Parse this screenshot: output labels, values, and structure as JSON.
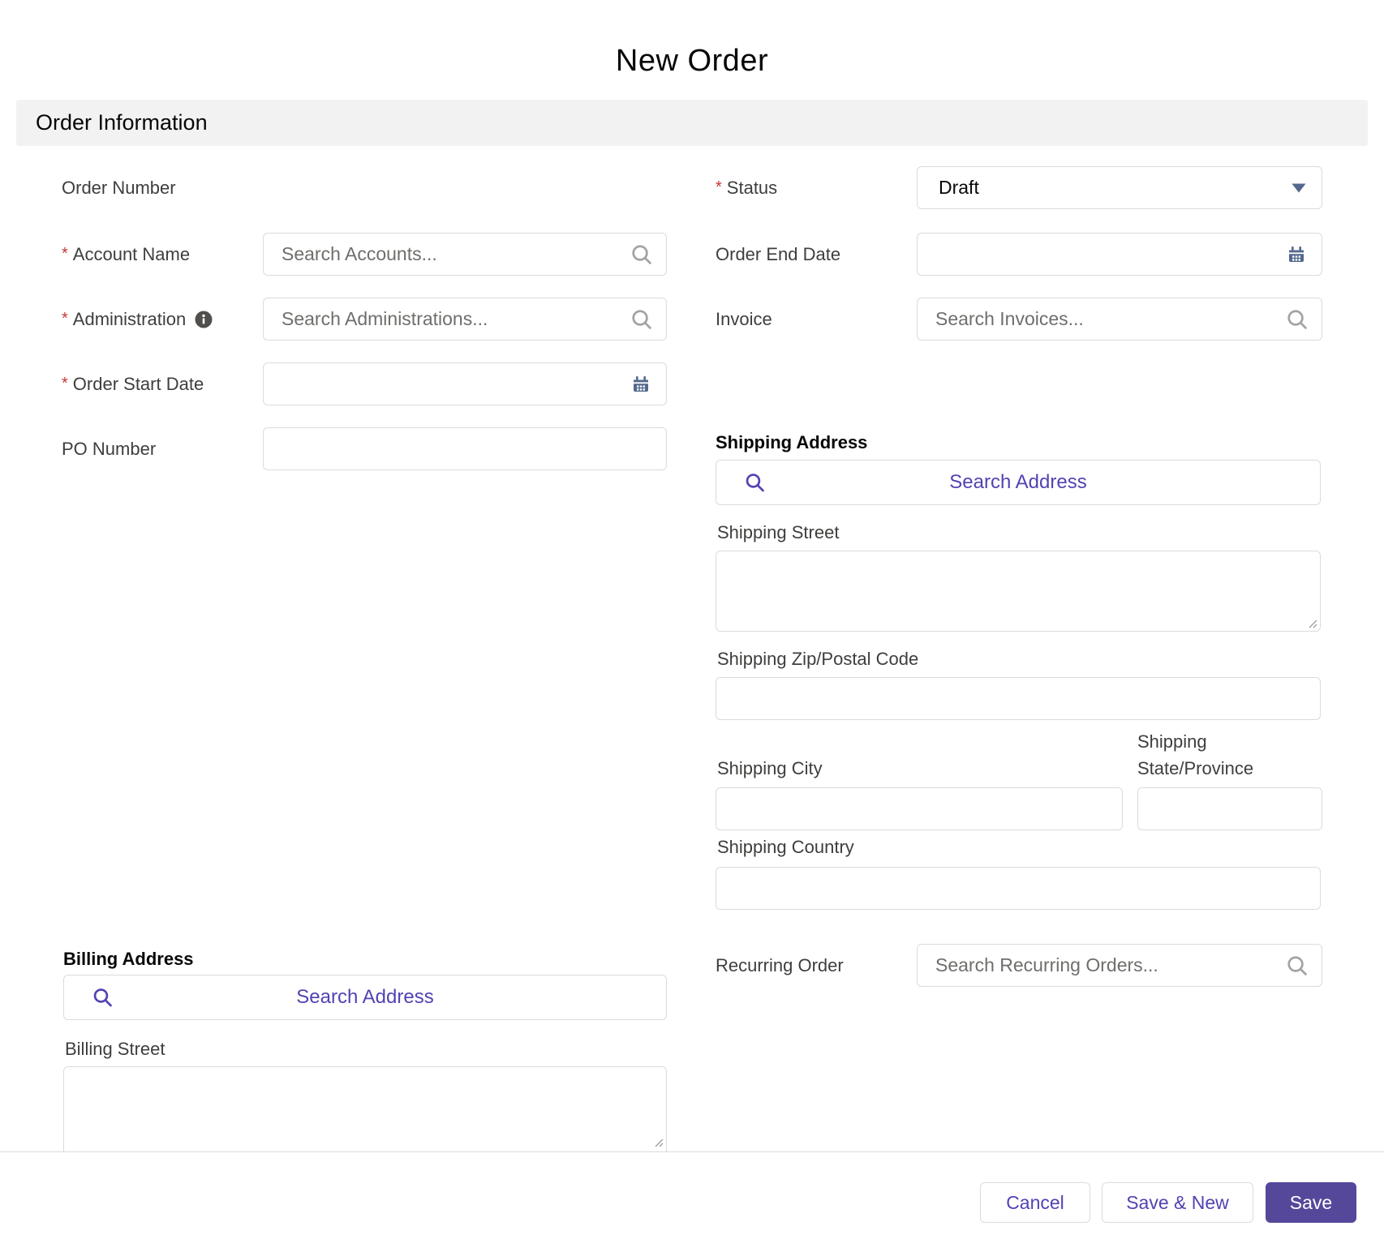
{
  "title": "New Order",
  "section_header": "Order Information",
  "colors": {
    "accent": "#5143b3",
    "save_bg": "#55489b",
    "icon_blue": "#54698d",
    "required_red": "#c23934"
  },
  "fields": {
    "order_number": {
      "label": "Order Number"
    },
    "account_name": {
      "label": "Account Name",
      "placeholder": "Search Accounts..."
    },
    "administration": {
      "label": "Administration",
      "placeholder": "Search Administrations..."
    },
    "order_start_date": {
      "label": "Order Start Date"
    },
    "po_number": {
      "label": "PO Number"
    },
    "status": {
      "label": "Status",
      "value": "Draft"
    },
    "order_end_date": {
      "label": "Order End Date"
    },
    "invoice": {
      "label": "Invoice",
      "placeholder": "Search Invoices..."
    },
    "recurring_order": {
      "label": "Recurring Order",
      "placeholder": "Search Recurring Orders..."
    }
  },
  "shipping": {
    "header": "Shipping Address",
    "search_button": "Search Address",
    "street_label": "Shipping Street",
    "zip_label": "Shipping Zip/Postal Code",
    "city_label": "Shipping City",
    "state_label": "Shipping State/Province",
    "country_label": "Shipping Country"
  },
  "billing": {
    "header": "Billing Address",
    "search_button": "Search Address",
    "street_label": "Billing Street"
  },
  "footer": {
    "cancel_label": "Cancel",
    "save_new_label": "Save & New",
    "save_label": "Save"
  }
}
